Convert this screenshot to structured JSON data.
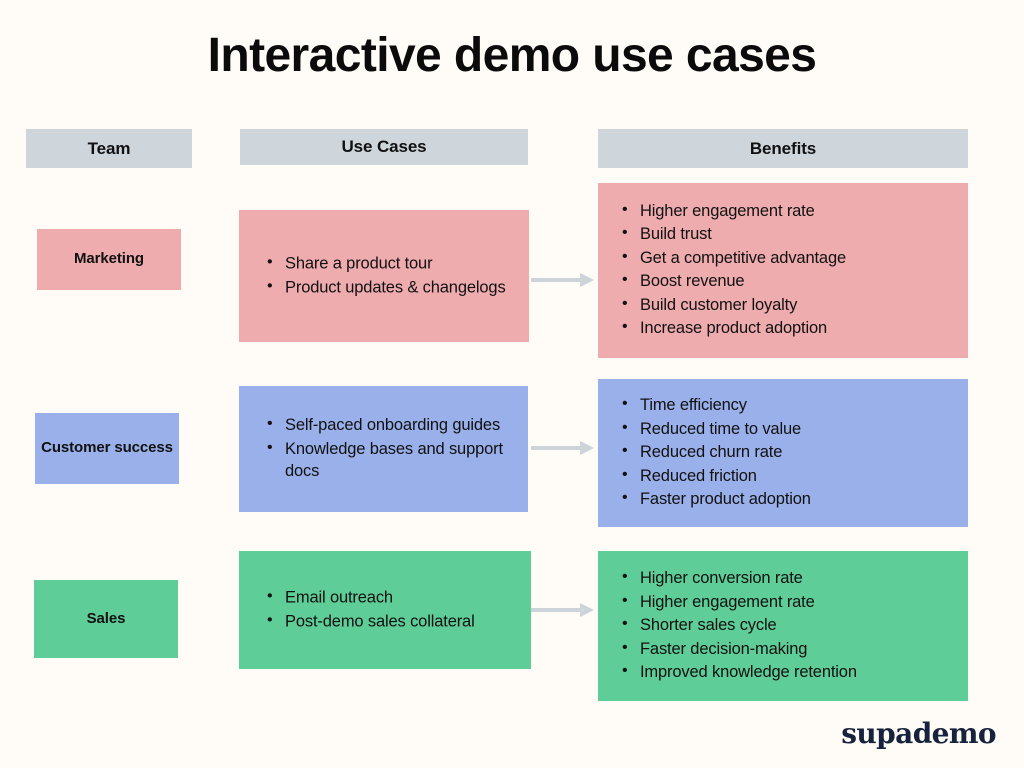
{
  "title": "Interactive demo use cases",
  "brand": "supademo",
  "colors": {
    "background": "#fffbf7",
    "header_bar": "#ced5db",
    "marketing": "#efacaf",
    "customer_success": "#9ab0ea",
    "sales": "#5ecd97",
    "arrow": "#ccd4da",
    "text": "#111111",
    "brand": "#17233c"
  },
  "headers": {
    "team": "Team",
    "use_cases": "Use Cases",
    "benefits": "Benefits"
  },
  "rows": [
    {
      "team": "Marketing",
      "color": "#efacaf",
      "use_cases": [
        "Share a product tour",
        "Product updates & changelogs"
      ],
      "benefits": [
        "Higher engagement rate",
        "Build trust",
        "Get a competitive advantage",
        "Boost revenue",
        "Build customer loyalty",
        "Increase product adoption"
      ]
    },
    {
      "team": "Customer success",
      "color": "#9ab0ea",
      "use_cases": [
        "Self-paced onboarding guides",
        "Knowledge bases and support docs"
      ],
      "benefits": [
        "Time efficiency",
        "Reduced time to value",
        "Reduced churn rate",
        "Reduced friction",
        "Faster product adoption"
      ]
    },
    {
      "team": "Sales",
      "color": "#5ecd97",
      "use_cases": [
        "Email outreach",
        "Post-demo sales collateral"
      ],
      "benefits": [
        "Higher conversion rate",
        "Higher engagement rate",
        "Shorter sales cycle",
        "Faster decision-making",
        "Improved knowledge retention"
      ]
    }
  ],
  "arrows": {
    "icon": "arrow-right-icon",
    "count": 3
  }
}
